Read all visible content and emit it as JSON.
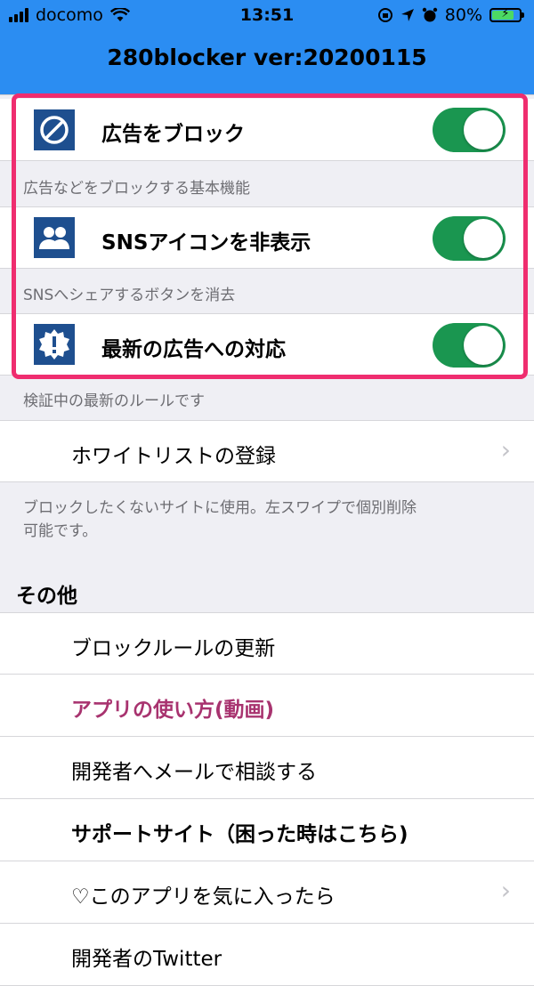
{
  "status_bar": {
    "carrier": "docomo",
    "time": "13:51",
    "battery": "80%",
    "battery_level": 0.8,
    "wifi_icon": "wifi-icon",
    "battery_icon": "battery-charging-icon"
  },
  "header": {
    "title": "280blocker ver:20200115",
    "color": "#2b8df2"
  },
  "toggles": [
    {
      "label": "広告をブロック",
      "footer": "広告などをブロックする基本機能",
      "icon": "block-icon",
      "on": true
    },
    {
      "label": "SNSアイコンを非表示",
      "footer": "SNSへシェアするボタンを消去",
      "icon": "people-icon",
      "on": true
    },
    {
      "label": "最新の広告への対応",
      "footer": "検証中の最新のルールです",
      "icon": "alert-badge-icon",
      "on": true
    }
  ],
  "whitelist": {
    "label": "ホワイトリストの登録",
    "footer_line1": "ブロックしたくないサイトに使用。左スワイプで個別削除",
    "footer_line2": "可能です。"
  },
  "other": {
    "section_title": "その他",
    "items": [
      {
        "label": "ブロックルールの更新"
      },
      {
        "label": "アプリの使い方(動画)",
        "color": "#a8336f"
      },
      {
        "label": "開発者へメールで相談する"
      },
      {
        "label": "サポートサイト（困った時はこちら)"
      },
      {
        "label": "♡このアプリを気に入ったら"
      },
      {
        "label": "開発者のTwitter"
      }
    ]
  },
  "colors": {
    "highlight": "#ef2d6f",
    "toggle_on": "#1a9650",
    "icon_bg": "#1e4f8f"
  }
}
